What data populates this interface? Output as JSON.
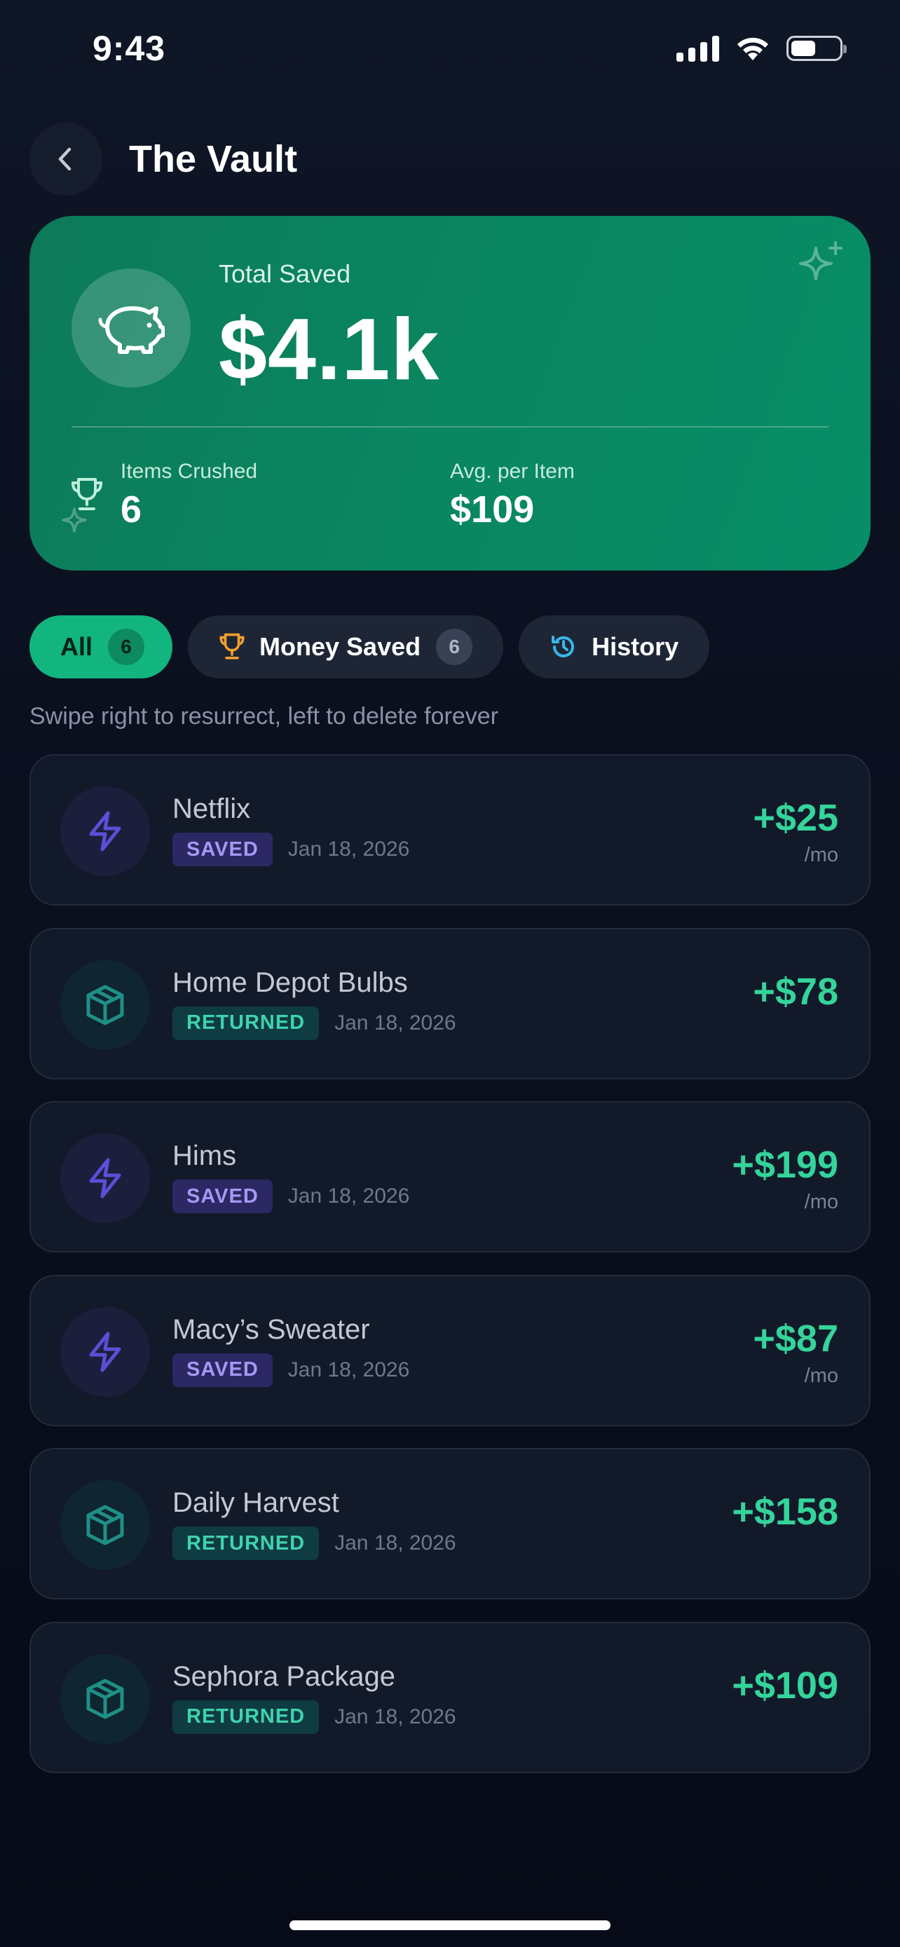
{
  "status_bar": {
    "time": "9:43"
  },
  "header": {
    "title": "The Vault"
  },
  "hero": {
    "label": "Total Saved",
    "amount": "$4.1k",
    "stats": [
      {
        "label": "Items Crushed",
        "value": "6"
      },
      {
        "label": "Avg. per Item",
        "value": "$109"
      }
    ]
  },
  "tabs": [
    {
      "label": "All",
      "count": "6",
      "icon": ""
    },
    {
      "label": "Money Saved",
      "count": "6",
      "icon": "trophy-icon"
    },
    {
      "label": "History",
      "icon": "history-icon"
    }
  ],
  "hint": "Swipe right to resurrect, left to delete forever",
  "items": [
    {
      "name": "Netflix",
      "tag": "SAVED",
      "date": "Jan 18, 2026",
      "amount": "+$25",
      "unit": "/mo",
      "icon": "lightning-icon"
    },
    {
      "name": "Home Depot Bulbs",
      "tag": "RETURNED",
      "date": "Jan 18, 2026",
      "amount": "+$78",
      "unit": "",
      "icon": "package-icon"
    },
    {
      "name": "Hims",
      "tag": "SAVED",
      "date": "Jan 18, 2026",
      "amount": "+$199",
      "unit": "/mo",
      "icon": "lightning-icon"
    },
    {
      "name": "Macy’s Sweater",
      "tag": "SAVED",
      "date": "Jan 18, 2026",
      "amount": "+$87",
      "unit": "/mo",
      "icon": "lightning-icon"
    },
    {
      "name": "Daily Harvest",
      "tag": "RETURNED",
      "date": "Jan 18, 2026",
      "amount": "+$158",
      "unit": "",
      "icon": "package-icon"
    },
    {
      "name": "Sephora Package",
      "tag": "RETURNED",
      "date": "Jan 18, 2026",
      "amount": "+$109",
      "unit": "",
      "icon": "package-icon"
    }
  ],
  "colors": {
    "accent_green": "#13b57f",
    "amount_green": "#34d49a",
    "saved_tag": "#a698f4",
    "returned_tag": "#3fd3ad",
    "hero_bg": "#0a8560"
  }
}
